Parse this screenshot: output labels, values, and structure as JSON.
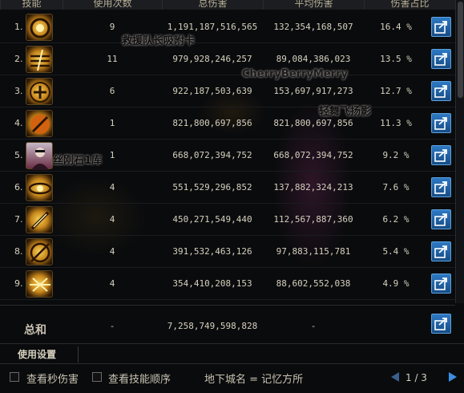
{
  "header": {
    "skill": "技能",
    "uses": "使用次数",
    "total": "总伤害",
    "avg": "平均伤害",
    "pct": "伤害占比"
  },
  "rows": [
    {
      "idx": "1.",
      "uses": "9",
      "total": "1,191,187,516,565",
      "avg": "132,354,168,507",
      "pct": "16.4 %",
      "icon": "gear-rune-skill-icon"
    },
    {
      "idx": "2.",
      "uses": "11",
      "total": "979,928,246,257",
      "avg": "89,084,386,023",
      "pct": "13.5 %",
      "icon": "flame-strikes-skill-icon"
    },
    {
      "idx": "3.",
      "uses": "6",
      "total": "922,187,503,639",
      "avg": "153,697,917,273",
      "pct": "12.7 %",
      "icon": "soul-text-skill-icon"
    },
    {
      "idx": "4.",
      "uses": "1",
      "total": "821,800,697,856",
      "avg": "821,800,697,856",
      "pct": "11.3 %",
      "icon": "slash-orb-skill-icon"
    },
    {
      "idx": "5.",
      "uses": "1",
      "total": "668,072,394,752",
      "avg": "668,072,394,752",
      "pct": "9.2 %",
      "icon": "character-portrait-icon"
    },
    {
      "idx": "6.",
      "uses": "4",
      "total": "551,529,296,852",
      "avg": "137,882,324,213",
      "pct": "7.6 %",
      "icon": "vortex-skill-icon"
    },
    {
      "idx": "7.",
      "uses": "4",
      "total": "450,271,549,440",
      "avg": "112,567,887,360",
      "pct": "6.2 %",
      "icon": "blade-skill-icon"
    },
    {
      "idx": "8.",
      "uses": "4",
      "total": "391,532,463,126",
      "avg": "97,883,115,781",
      "pct": "5.4 %",
      "icon": "spear-circle-skill-icon"
    },
    {
      "idx": "9.",
      "uses": "4",
      "total": "354,410,208,153",
      "avg": "88,602,552,038",
      "pct": "4.9 %",
      "icon": "burst-skill-icon"
    }
  ],
  "overlays": {
    "player1": "救援队长吸附卡",
    "player2": "CherryBerryMerry",
    "player3": "轻舞飞扬影",
    "player4": "丝刚石1库"
  },
  "summary": {
    "label": "总和",
    "uses": "-",
    "total": "7,258,749,598,828",
    "avg": "-"
  },
  "settings": {
    "label": "使用设置"
  },
  "footer": {
    "dps_label": "查看秒伤害",
    "order_label": "查看技能顺序",
    "dungeon": "地下城名 = 记忆方所",
    "page": "1 / 3"
  },
  "colors": {
    "accent": "#2e79c4",
    "gold": "#f6d25a"
  }
}
